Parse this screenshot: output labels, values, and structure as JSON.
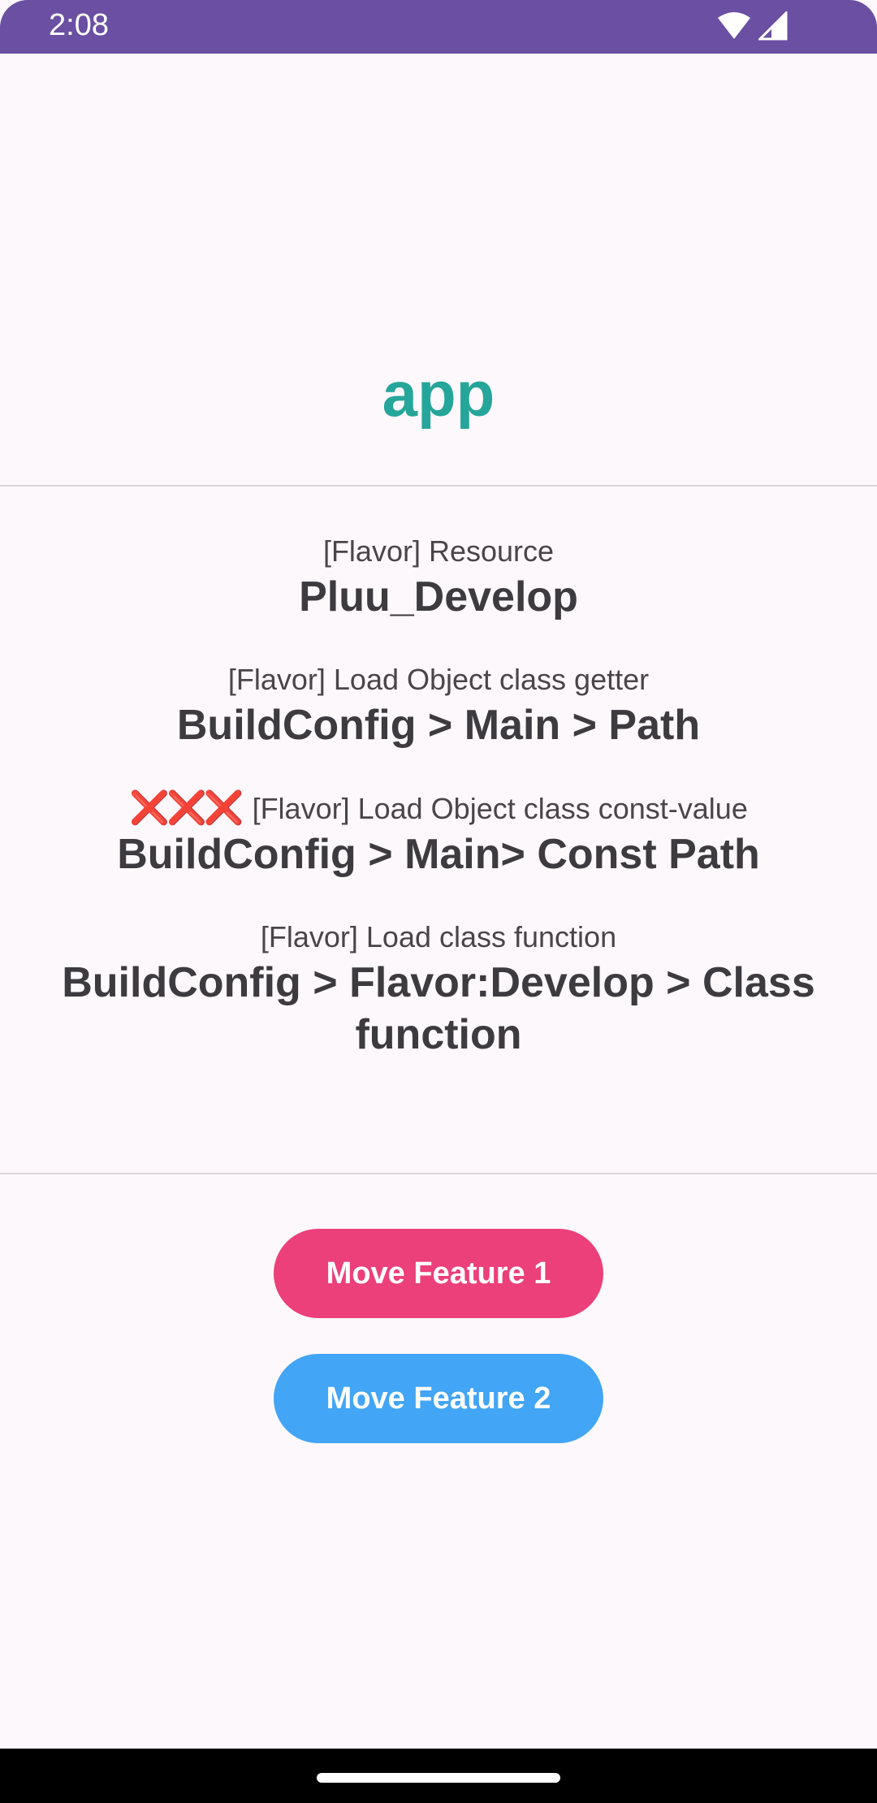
{
  "status_bar": {
    "time": "2:08",
    "background": "#6a4fa3",
    "icons": [
      "wifi-icon",
      "signal-icon"
    ]
  },
  "app": {
    "title": "app",
    "title_color": "#26a69a"
  },
  "info_items": [
    {
      "prefix": "",
      "label": "[Flavor] Resource",
      "value": "Pluu_Develop"
    },
    {
      "prefix": "",
      "label": "[Flavor] Load Object class getter",
      "value": "BuildConfig > Main > Path"
    },
    {
      "prefix": "❌❌❌",
      "label": "[Flavor] Load Object class const-value",
      "value": "BuildConfig > Main> Const Path"
    },
    {
      "prefix": "",
      "label": "[Flavor] Load class function",
      "value": "BuildConfig > Flavor:Develop > Class function"
    }
  ],
  "buttons": {
    "feature1": {
      "label": "Move Feature 1",
      "color": "#ec407a"
    },
    "feature2": {
      "label": "Move Feature 2",
      "color": "#42a5f5"
    }
  }
}
